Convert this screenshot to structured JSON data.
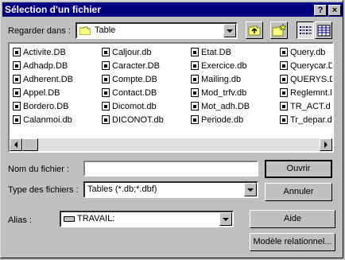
{
  "title": "Sélection d'un fichier",
  "titlebar_buttons": {
    "help": "?",
    "close": "×"
  },
  "lookin": {
    "label": "Regarder dans :",
    "value": "Table"
  },
  "files": [
    [
      "Activite.DB",
      "Adhadp.DB",
      "Adherent.DB",
      "Appel.DB",
      "Bordero.DB",
      "Calanmoi.db"
    ],
    [
      "Caljour.db",
      "Caracter.DB",
      "Compte.DB",
      "Contact.DB",
      "Dicomot.db",
      "DICONOT.db"
    ],
    [
      "Etat.DB",
      "Exercice.db",
      "Mailing.db",
      "Mod_trfv.db",
      "Mot_adh.DB",
      "Periode.db"
    ],
    [
      "Query.db",
      "Querycar.DB",
      "QUERYS.D",
      "Reglemnt.l",
      "TR_ACT.d",
      "Tr_depar.d"
    ]
  ],
  "filename": {
    "label": "Nom du fichier :",
    "value": ""
  },
  "filetype": {
    "label": "Type des fichiers :",
    "value": "Tables (*.db;*.dbf)"
  },
  "alias": {
    "label": "Alias :",
    "value": "TRAVAIL:"
  },
  "buttons": {
    "open": "Ouvrir",
    "cancel": "Annuler",
    "help": "Aide",
    "model": "Modèle relationnel..."
  }
}
